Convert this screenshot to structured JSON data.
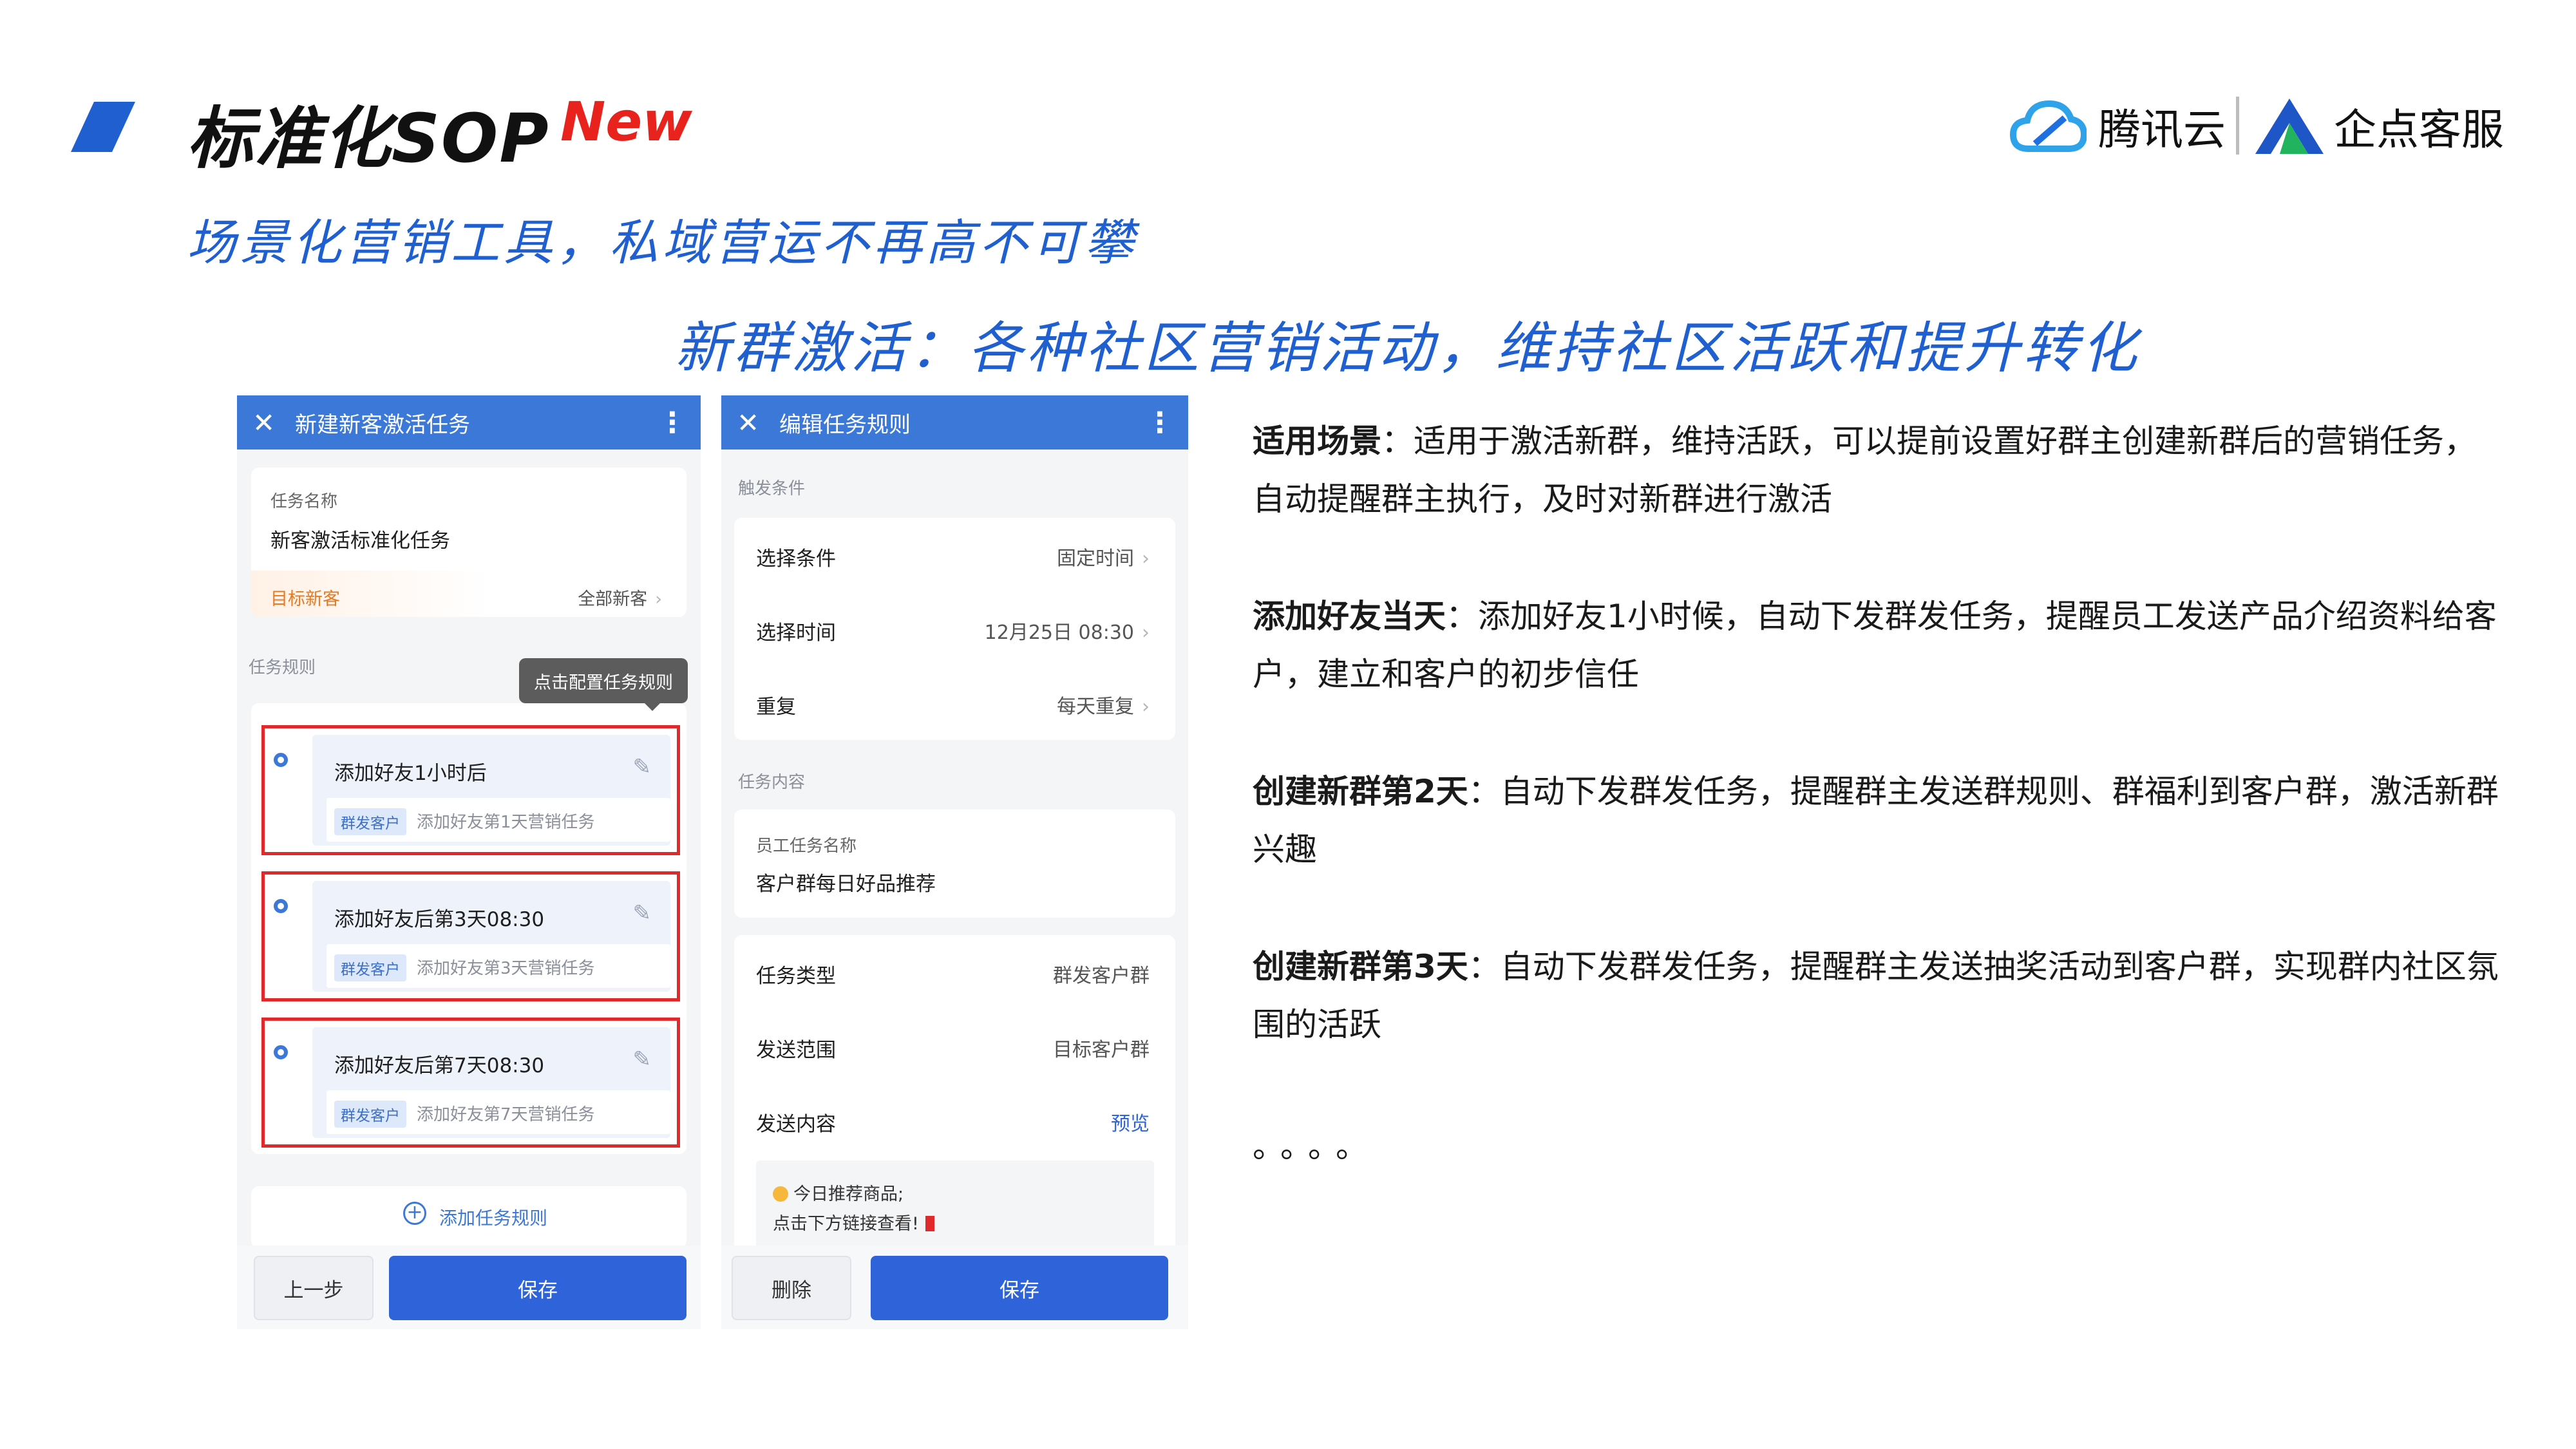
{
  "header": {
    "title": "标准化SOP",
    "badge": "New",
    "subtitle": "场景化营销工具，私域营运不再高不可攀",
    "headline": "新群激活：各种社区营销活动，维持社区活跃和提升转化",
    "logo_tencent": "腾讯云",
    "logo_qidian": "企点客服",
    "colors": {
      "accent": "#1f5fd0",
      "badge": "#e8231e",
      "mark": "#1f5fd0"
    }
  },
  "phone1": {
    "title": "新建新客激活任务",
    "close_icon": "close-icon",
    "more_icon": "more-vertical-icon",
    "task_name_label": "任务名称",
    "task_name_value": "新客激活标准化任务",
    "target_label": "目标新客",
    "target_value": "全部新客",
    "rules_label": "任务规则",
    "tooltip": "点击配置任务规则",
    "rules": [
      {
        "name": "添加好友1小时后",
        "tag": "群发客户",
        "desc": "添加好友第1天营销任务"
      },
      {
        "name": "添加好友后第3天08:30",
        "tag": "群发客户",
        "desc": "添加好友第3天营销任务"
      },
      {
        "name": "添加好友后第7天08:30",
        "tag": "群发客户",
        "desc": "添加好友第7天营销任务"
      }
    ],
    "add_rule": "添加任务规则",
    "btn_prev": "上一步",
    "btn_save": "保存"
  },
  "phone2": {
    "title": "编辑任务规则",
    "trigger_label": "触发条件",
    "trigger_rows": [
      {
        "key": "选择条件",
        "value": "固定时间"
      },
      {
        "key": "选择时间",
        "value": "12月25日 08:30"
      },
      {
        "key": "重复",
        "value": "每天重复"
      }
    ],
    "content_label": "任务内容",
    "staff_task_label": "员工任务名称",
    "staff_task_value": "客户群每日好品推荐",
    "type_key": "任务类型",
    "type_value": "群发客户群",
    "range_key": "发送范围",
    "range_value": "目标客户群",
    "content_key": "发送内容",
    "content_link": "预览",
    "preview_line1": "今日推荐商品;",
    "preview_line2": "点击下方链接查看!",
    "btn_delete": "删除",
    "btn_save": "保存"
  },
  "descriptions": [
    {
      "title": "适用场景",
      "text": "：适用于激活新群，维持活跃，可以提前设置好群主创建新群后的营销任务，自动提醒群主执行，及时对新群进行激活"
    },
    {
      "title": "添加好友当天",
      "text": "：添加好友1小时候，自动下发群发任务，提醒员工发送产品介绍资料给客户，建立和客户的初步信任"
    },
    {
      "title": "创建新群第2天",
      "text": "：自动下发群发任务，提醒群主发送群规则、群福利到客户群，激活新群兴趣"
    },
    {
      "title": "创建新群第3天",
      "text": "：自动下发群发任务，提醒群主发送抽奖活动到客户群，实现群内社区氛围的活跃"
    }
  ],
  "ellipsis": "。。。。"
}
